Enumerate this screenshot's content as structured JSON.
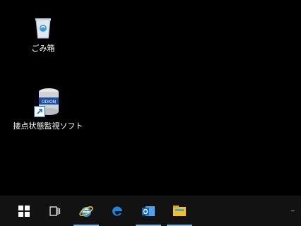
{
  "desktop": {
    "icons": [
      {
        "label": "ごみ箱",
        "icon": "recycle-bin-icon"
      },
      {
        "label": "接点状態監視ソフト",
        "icon": "database-app-icon",
        "badge": "ODION"
      }
    ]
  },
  "taskbar": {
    "buttons": [
      {
        "name": "start-button",
        "icon": "windows-logo-icon"
      },
      {
        "name": "task-view-button",
        "icon": "task-view-icon"
      },
      {
        "name": "internet-explorer-button",
        "icon": "ie-icon",
        "active": true
      },
      {
        "name": "edge-button",
        "icon": "edge-icon"
      },
      {
        "name": "outlook-button",
        "icon": "outlook-icon",
        "active": true
      },
      {
        "name": "file-explorer-button",
        "icon": "folder-icon",
        "active": true
      }
    ],
    "tray": {
      "line1": "—",
      "line2": ""
    }
  },
  "colors": {
    "desktop_bg": "#000000",
    "taskbar_bg": "#121212",
    "active_indicator": "#76b9ed"
  }
}
